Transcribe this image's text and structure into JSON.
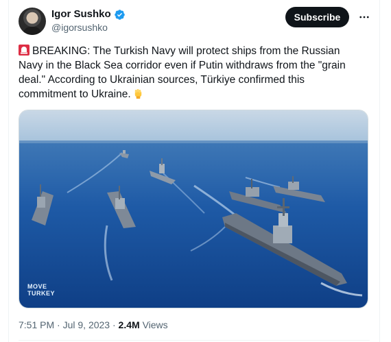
{
  "author": {
    "name": "Igor Sushko",
    "handle": "@igorsushko",
    "verified": true,
    "verified_color": "#1d9bf0"
  },
  "actions": {
    "subscribe_label": "Subscribe",
    "more_icon": "ellipsis-icon"
  },
  "tweet": {
    "text": "BREAKING: The Turkish Navy will protect ships from the Russian Navy in the Black Sea corridor even if Putin withdraws from the \"grain deal.\" According to Ukrainian sources, Türkiye confirmed this commitment to Ukraine.",
    "leading_icon": "siren-icon",
    "trailing_icon": "raised-fist-icon"
  },
  "media": {
    "watermark_line1": "MOVE",
    "watermark_line2": "TURKEY"
  },
  "meta": {
    "time": "7:51 PM",
    "separator": "·",
    "date": "Jul 9, 2023",
    "views_count": "2.4M",
    "views_label": "Views"
  }
}
